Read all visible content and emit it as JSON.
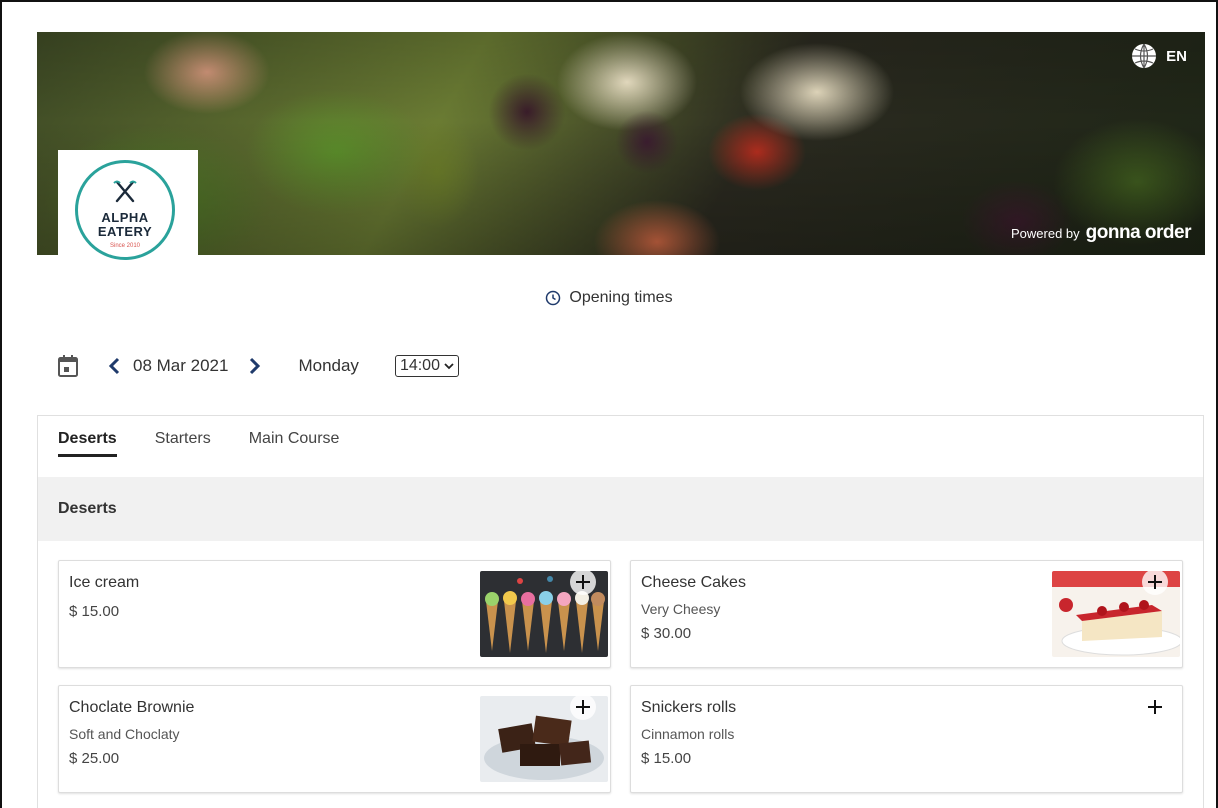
{
  "header": {
    "language": "EN",
    "powered_by": "Powered by",
    "powered_brand": "gonna order"
  },
  "logo": {
    "line1": "ALPHA",
    "line2": "EATERY",
    "since": "Since 2010"
  },
  "opening_times_label": "Opening times",
  "date_nav": {
    "date": "08 Mar 2021",
    "weekday": "Monday",
    "time": "14:00"
  },
  "tabs": [
    {
      "label": "Deserts",
      "active": true
    },
    {
      "label": "Starters",
      "active": false
    },
    {
      "label": "Main Course",
      "active": false
    }
  ],
  "section_title": "Deserts",
  "items": [
    {
      "name": "Ice cream",
      "description": "",
      "price": "$ 15.00",
      "has_image": true
    },
    {
      "name": "Cheese Cakes",
      "description": "Very Cheesy",
      "price": "$ 30.00",
      "has_image": true
    },
    {
      "name": "Choclate Brownie",
      "description": "Soft and Choclaty",
      "price": "$ 25.00",
      "has_image": true
    },
    {
      "name": "Snickers rolls",
      "description": "Cinnamon rolls",
      "price": "$ 15.00",
      "has_image": false
    }
  ],
  "colors": {
    "logo_teal": "#2aa29b",
    "logo_navy": "#1b2a3a",
    "section_bg": "#f1f1f1",
    "nav_arrow": "#1f3a6b"
  },
  "icons": {
    "language": "globe-icon",
    "opening": "clock-icon",
    "calendar": "calendar-icon",
    "prev": "chevron-left-icon",
    "next": "chevron-right-icon",
    "dropdown": "chevron-down-icon",
    "add": "plus-icon",
    "logo": "fork-knife-icon"
  }
}
